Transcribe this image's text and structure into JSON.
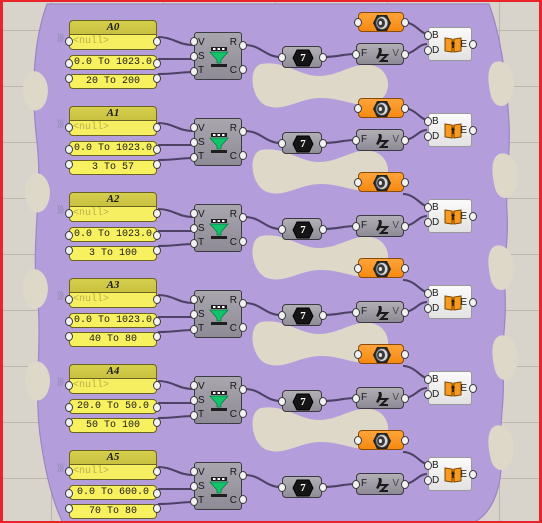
{
  "app": {
    "name": "Grasshopper Canvas",
    "background_color": "#d8d4cc",
    "group_color": "#b39ddb",
    "selection_border_color": "#e8232a",
    "grid_color": "#bbb7ad"
  },
  "group": {
    "name": "purple-group-region",
    "fill": "#b39ddb"
  },
  "rows": [
    {
      "id": "A0",
      "slider_group": {
        "title": "A0",
        "null_text": "<null>",
        "sliders": [
          "0.0 To 1023.0",
          "20 To 200"
        ]
      },
      "remap": {
        "inputs": [
          "V",
          "S",
          "T"
        ],
        "outputs": [
          "R",
          "C"
        ],
        "icon": "funnel-icon"
      },
      "number": {
        "value": "7",
        "icon": "hexagon-icon"
      },
      "orange": {
        "icon": "disc-icon"
      },
      "expression": {
        "inputs": [
          "F"
        ],
        "outputs": [
          "V"
        ],
        "icon": "z-expression-icon"
      },
      "panel": {
        "inputs": [
          "B",
          "D"
        ],
        "outputs": [
          "E"
        ],
        "icon": "book-icon"
      }
    },
    {
      "id": "A1",
      "slider_group": {
        "title": "A1",
        "null_text": "<null>",
        "sliders": [
          "0.0 To 1023.0",
          "3 To 57"
        ]
      },
      "remap": {
        "inputs": [
          "V",
          "S",
          "T"
        ],
        "outputs": [
          "R",
          "C"
        ],
        "icon": "funnel-icon"
      },
      "number": {
        "value": "7",
        "icon": "hexagon-icon"
      },
      "orange": {
        "icon": "disc-icon"
      },
      "expression": {
        "inputs": [
          "F"
        ],
        "outputs": [
          "V"
        ],
        "icon": "z-expression-icon"
      },
      "panel": {
        "inputs": [
          "B",
          "D"
        ],
        "outputs": [
          "E"
        ],
        "icon": "book-icon"
      }
    },
    {
      "id": "A2",
      "slider_group": {
        "title": "A2",
        "null_text": "<null>",
        "sliders": [
          "0.0 To 1023.0",
          "3 To 100"
        ]
      },
      "remap": {
        "inputs": [
          "V",
          "S",
          "T"
        ],
        "outputs": [
          "R",
          "C"
        ],
        "icon": "funnel-icon"
      },
      "number": {
        "value": "7",
        "icon": "hexagon-icon"
      },
      "orange": {
        "icon": "disc-icon"
      },
      "expression": {
        "inputs": [
          "F"
        ],
        "outputs": [
          "V"
        ],
        "icon": "z-expression-icon"
      },
      "panel": {
        "inputs": [
          "B",
          "D"
        ],
        "outputs": [
          "E"
        ],
        "icon": "book-icon"
      }
    },
    {
      "id": "A3",
      "slider_group": {
        "title": "A3",
        "null_text": "<null>",
        "sliders": [
          "0.0 To 1023.0",
          "40 To 80"
        ]
      },
      "remap": {
        "inputs": [
          "V",
          "S",
          "T"
        ],
        "outputs": [
          "R",
          "C"
        ],
        "icon": "funnel-icon"
      },
      "number": {
        "value": "7",
        "icon": "hexagon-icon"
      },
      "orange": {
        "icon": "disc-icon"
      },
      "expression": {
        "inputs": [
          "F"
        ],
        "outputs": [
          "V"
        ],
        "icon": "z-expression-icon"
      },
      "panel": {
        "inputs": [
          "B",
          "D"
        ],
        "outputs": [
          "E"
        ],
        "icon": "book-icon"
      }
    },
    {
      "id": "A4",
      "slider_group": {
        "title": "A4",
        "null_text": "<null>",
        "sliders": [
          "20.0 To 50.0",
          "50 To 100"
        ]
      },
      "remap": {
        "inputs": [
          "V",
          "S",
          "T"
        ],
        "outputs": [
          "R",
          "C"
        ],
        "icon": "funnel-icon"
      },
      "number": {
        "value": "7",
        "icon": "hexagon-icon"
      },
      "orange": {
        "icon": "disc-icon"
      },
      "expression": {
        "inputs": [
          "F"
        ],
        "outputs": [
          "V"
        ],
        "icon": "z-expression-icon"
      },
      "panel": {
        "inputs": [
          "B",
          "D"
        ],
        "outputs": [
          "E"
        ],
        "icon": "book-icon"
      }
    },
    {
      "id": "A5",
      "slider_group": {
        "title": "A5",
        "null_text": "<null>",
        "sliders": [
          "0.0 To 600.0",
          "70 To 80"
        ]
      },
      "remap": {
        "inputs": [
          "V",
          "S",
          "T"
        ],
        "outputs": [
          "R",
          "C"
        ],
        "icon": "funnel-icon"
      },
      "number": {
        "value": "7",
        "icon": "hexagon-icon"
      },
      "orange": {
        "icon": "disc-icon"
      },
      "expression": {
        "inputs": [
          "F"
        ],
        "outputs": [
          "V"
        ],
        "icon": "z-expression-icon"
      },
      "panel": {
        "inputs": [
          "B",
          "D"
        ],
        "outputs": [
          "E"
        ],
        "icon": "book-icon"
      }
    }
  ]
}
